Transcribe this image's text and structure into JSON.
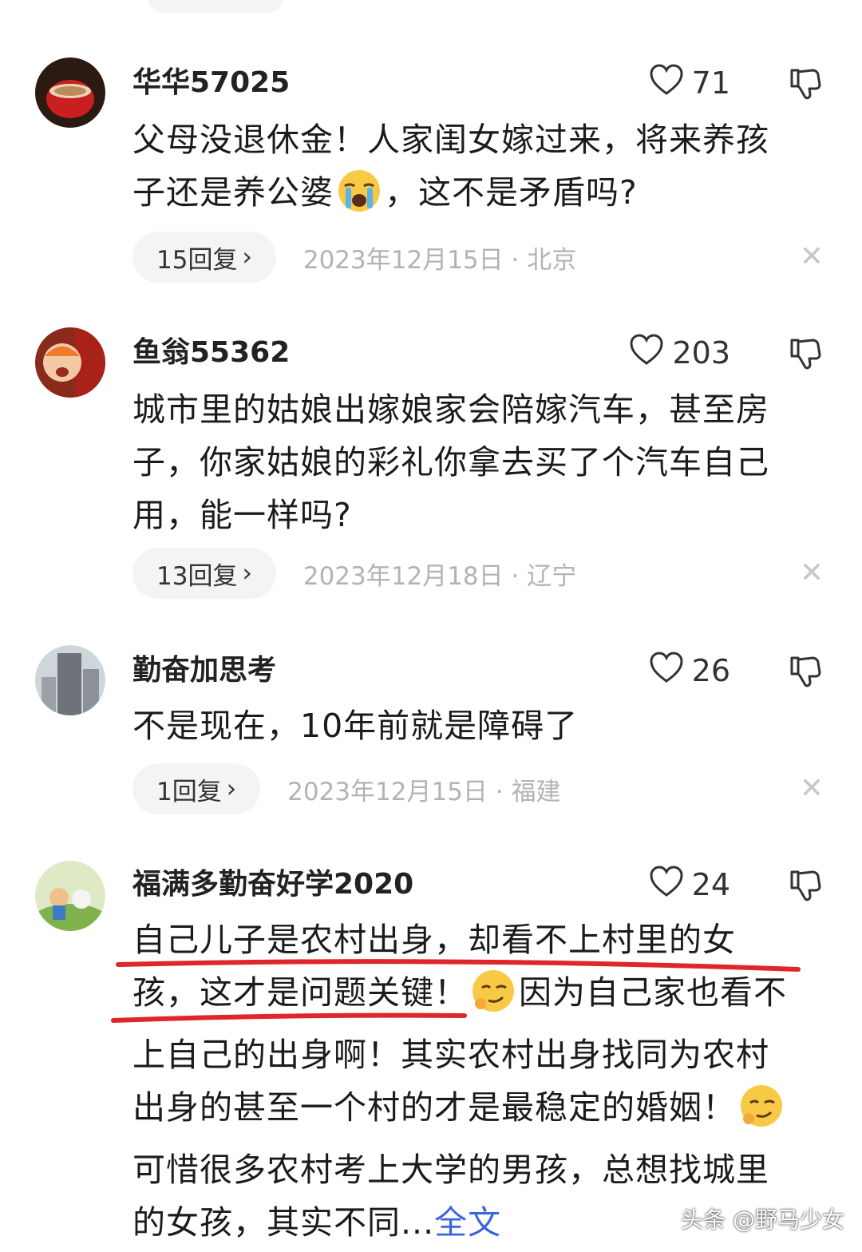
{
  "comments": [
    {
      "username": "华华57025",
      "likes": "71",
      "text_lines": [
        "父母没退休金！人家闺女嫁过来，将来养孩",
        "子还是养公婆",
        "，这不是矛盾吗?"
      ],
      "replies": "15回复",
      "date": "2023年12月15日",
      "sep": "·",
      "location": "北京"
    },
    {
      "username": "鱼翁55362",
      "likes": "203",
      "text_lines": [
        "城市里的姑娘出嫁娘家会陪嫁汽车，甚至房",
        "子，你家姑娘的彩礼你拿去买了个汽车自己",
        "用，能一样吗?"
      ],
      "replies": "13回复",
      "date": "2023年12月18日",
      "sep": "·",
      "location": "辽宁"
    },
    {
      "username": "勤奋加思考",
      "likes": "26",
      "text_lines": [
        "不是现在，10年前就是障碍了"
      ],
      "replies": "1回复",
      "date": "2023年12月15日",
      "sep": "·",
      "location": "福建"
    },
    {
      "username": "福满多勤奋好学2020",
      "likes": "24",
      "text_lines": [
        "自己儿子是农村出身，却看不上村里的女",
        "孩，这才是问题关键！",
        "因为自己家也看不",
        "上自己的出身啊！其实农村出身找同为农村",
        "出身的甚至一个村的才是最稳定的婚姻！",
        "可惜很多农村考上大学的男孩，总想找城里",
        "的女孩，其实不同..."
      ],
      "more_label": "全文"
    }
  ],
  "icons": {
    "like": "heart-outline-icon",
    "dislike": "thumbs-down-icon",
    "chevron": "chevron-right-icon",
    "close": "close-icon",
    "emoji_crying": "crying-face-emoji",
    "emoji_smirk": "smirking-face-emoji"
  },
  "chevron_glyph": "›",
  "close_glyph": "✕",
  "watermark": "头条 @野马少女",
  "colors": {
    "underline": "#e0262b",
    "link": "#3b66d6",
    "muted": "#b3b3b3"
  }
}
